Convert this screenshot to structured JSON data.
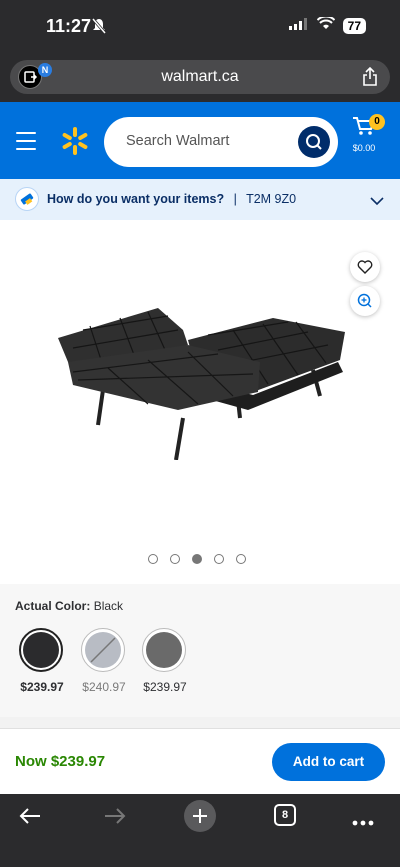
{
  "status_bar": {
    "time": "11:27",
    "battery": "77"
  },
  "browser": {
    "url": "walmart.ca",
    "tab_badge": "N",
    "tabs_count": "8"
  },
  "header": {
    "search_placeholder": "Search Walmart",
    "cart_count": "0",
    "cart_total": "$0.00",
    "brand_color": "#0071dc",
    "spark_color": "#ffc220"
  },
  "delivery": {
    "question": "How do you want your items?",
    "separator": "|",
    "postal_code": "T2M 9Z0"
  },
  "gallery": {
    "image_count": 5,
    "active_index": 2
  },
  "variants": {
    "label": "Actual Color:",
    "selected_value": "Black",
    "options": [
      {
        "name": "Black",
        "price": "$239.97",
        "swatch_color": "#2b2b2d",
        "selected": true,
        "available": true
      },
      {
        "name": "Light Grey",
        "price": "$240.97",
        "swatch_color": "#b8bcc4",
        "selected": false,
        "available": false
      },
      {
        "name": "Dark Grey",
        "price": "$239.97",
        "swatch_color": "#6a6a6a",
        "selected": false,
        "available": true
      }
    ]
  },
  "purchase": {
    "now_price": "Now $239.97",
    "add_to_cart_label": "Add to cart",
    "price_color": "#2a8703"
  }
}
